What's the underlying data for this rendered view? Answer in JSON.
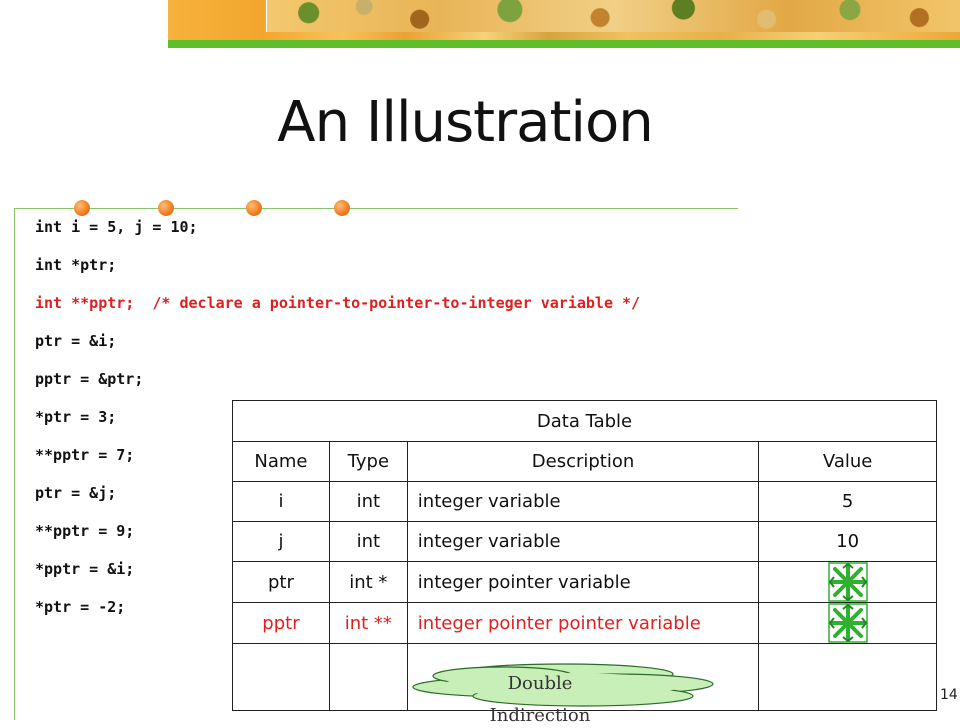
{
  "slide": {
    "title": "An Illustration",
    "page_number": "14"
  },
  "code_lines": [
    "int i = 5, j = 10;",
    "int *ptr;",
    "int **pptr;  /* declare a pointer-to-pointer-to-integer variable */",
    "ptr = &i;",
    "pptr = &ptr;",
    "*ptr = 3;",
    "**pptr = 7;",
    "ptr = &j;",
    "**pptr = 9;",
    "*pptr = &i;",
    "*ptr = -2;"
  ],
  "table": {
    "caption": "Data Table",
    "headers": [
      "Name",
      "Type",
      "Description",
      "Value"
    ],
    "rows": [
      {
        "name": "i",
        "type": "int",
        "description": "integer variable",
        "value": "5"
      },
      {
        "name": "j",
        "type": "int",
        "description": "integer variable",
        "value": "10"
      },
      {
        "name": "ptr",
        "type": "int *",
        "description": "integer pointer variable",
        "value": ""
      },
      {
        "name": "pptr",
        "type": "int **",
        "description": "integer pointer pointer variable",
        "value": ""
      }
    ]
  },
  "callout": {
    "line1": "Double",
    "line2": "Indirection"
  },
  "colors": {
    "highlight": "#e02020",
    "accent_green": "#5fbf2a",
    "bullet_orange": "#f07b1e",
    "star_green": "#2fb02f"
  }
}
